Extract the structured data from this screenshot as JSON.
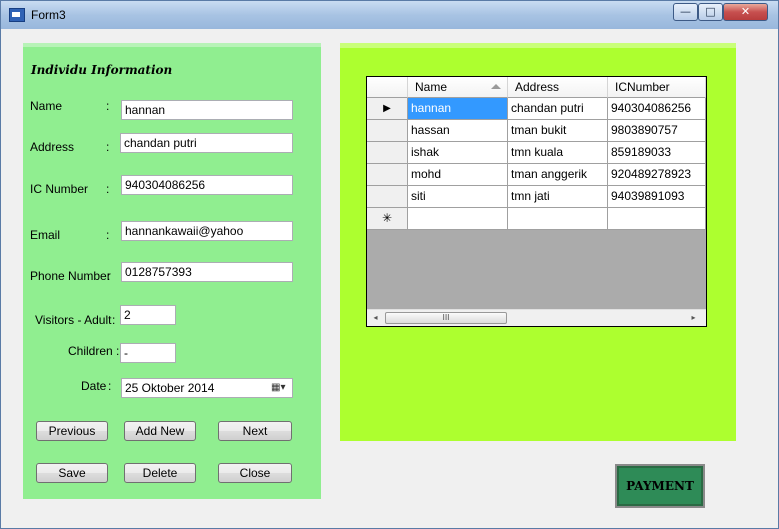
{
  "window": {
    "title": "Form3",
    "min_glyph": "—",
    "max_glyph": "□",
    "close_glyph": "✕"
  },
  "form": {
    "title": "Individu Information",
    "fields": {
      "name": {
        "label": "Name",
        "colon": ":",
        "value": "hannan"
      },
      "address": {
        "label": "Address",
        "colon": ":",
        "value": "chandan putri"
      },
      "ic": {
        "label": "IC Number",
        "colon": ":",
        "value": "940304086256"
      },
      "email": {
        "label": "Email",
        "colon": ":",
        "value": "hannankawaii@yahoo"
      },
      "phone": {
        "label": "Phone Number",
        "colon": ":",
        "value": "0128757393"
      },
      "adult": {
        "label": "Visitors -  Adult",
        "colon": ":",
        "value": "2"
      },
      "children": {
        "label": "Children :",
        "value": "-"
      },
      "date": {
        "label": "Date",
        "colon": ":",
        "value": "25  Oktober  2014",
        "icon": "calendar-dropdown-icon",
        "icon_glyph": "▦▾"
      }
    },
    "buttons": {
      "previous": "Previous",
      "add_new": "Add New",
      "next": "Next",
      "save": "Save",
      "delete": "Delete",
      "close": "Close"
    }
  },
  "grid": {
    "columns": [
      "Name",
      "Address",
      "ICNumber"
    ],
    "sort_icon": "sort-ascending-icon",
    "current_row_marker": "▶",
    "new_row_marker": "✳",
    "rows": [
      {
        "name": "hannan",
        "address": "chandan putri",
        "ic": "940304086256"
      },
      {
        "name": "hassan",
        "address": "tman bukit",
        "ic": "9803890757"
      },
      {
        "name": "ishak",
        "address": "tmn kuala",
        "ic": "859189033"
      },
      {
        "name": "mohd",
        "address": "tman anggerik",
        "ic": "920489278923"
      },
      {
        "name": "siti",
        "address": "tmn jati",
        "ic": "94039891093"
      }
    ],
    "scroll": {
      "left": "◂",
      "right": "▸",
      "thumb": "III"
    }
  },
  "payment_label": "PAYMENT",
  "colors": {
    "left_panel": "#90ee90",
    "right_panel": "#adff2f",
    "payment": "#2e8b57",
    "selection": "#3399ff"
  }
}
